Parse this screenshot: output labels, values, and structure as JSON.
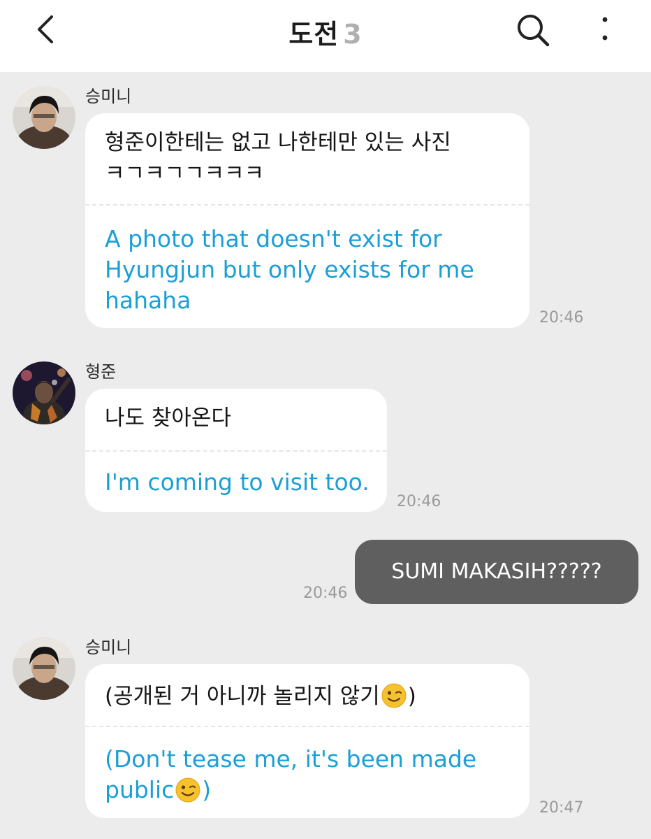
{
  "header": {
    "title": "도전",
    "member_count": "3",
    "icons": {
      "back": "chevron-left-icon",
      "search": "search-icon",
      "more": "more-vertical-icon"
    }
  },
  "messages": [
    {
      "sender": "승미니",
      "text": "형준이한테는 없고 나한테만 있는 사진\nㅋㄱㅋㄱㄱㅋㅋㅋ",
      "translation": "A photo that doesn't exist for\nHyungjun but only exists for me\nhahaha",
      "time": "20:46"
    },
    {
      "sender": "형준",
      "text": "나도 찾아온다",
      "translation": "I'm coming to visit too.",
      "time": "20:46"
    },
    {
      "sender": "me",
      "text": "SUMI MAKASIH?????",
      "time": "20:46"
    },
    {
      "sender": "승미니",
      "text_before_emoji": "(공개된 거 아니까 놀리지 않기",
      "text_after_emoji": ")",
      "translation_before_emoji": "(Don't tease me, it's been made\npublic",
      "translation_after_emoji": ")",
      "emoji": "winking-face-icon",
      "time": "20:47"
    }
  ],
  "colors": {
    "background": "#ececec",
    "bubble_incoming": "#ffffff",
    "bubble_outgoing": "#5f5f5f",
    "translation_text": "#1b9fd6",
    "time_text": "#9a9a9a"
  }
}
